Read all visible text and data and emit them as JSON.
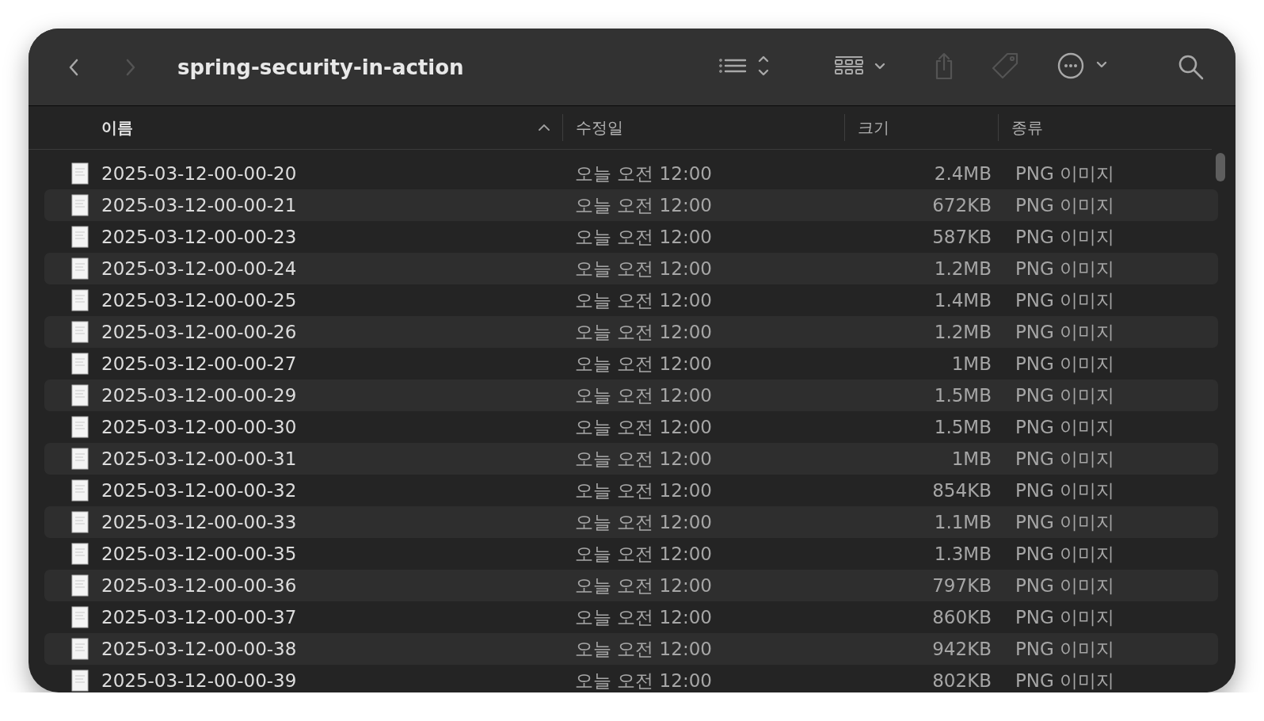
{
  "window": {
    "title": "spring-security-in-action"
  },
  "navigation": [
    {
      "kind": "back",
      "disabled": false
    },
    {
      "kind": "forward",
      "disabled": true
    }
  ],
  "toolbar": [
    {
      "kind": "list-view",
      "disabled": false
    },
    {
      "kind": "group",
      "disabled": false
    },
    {
      "kind": "share",
      "disabled": true
    },
    {
      "kind": "tag",
      "disabled": true
    },
    {
      "kind": "more",
      "disabled": false
    },
    {
      "kind": "search",
      "disabled": false
    }
  ],
  "columns": [
    {
      "label": "이름",
      "sorted": true
    },
    {
      "label": "수정일",
      "sorted": false
    },
    {
      "label": "크기",
      "sorted": false
    },
    {
      "label": "종류",
      "sorted": false
    }
  ],
  "rows": [
    {
      "name": "2025-03-12-00-00-20",
      "modified": "오늘 오전 12:00",
      "size": "2.4MB",
      "kind": "PNG 이미지"
    },
    {
      "name": "2025-03-12-00-00-21",
      "modified": "오늘 오전 12:00",
      "size": "672KB",
      "kind": "PNG 이미지"
    },
    {
      "name": "2025-03-12-00-00-23",
      "modified": "오늘 오전 12:00",
      "size": "587KB",
      "kind": "PNG 이미지"
    },
    {
      "name": "2025-03-12-00-00-24",
      "modified": "오늘 오전 12:00",
      "size": "1.2MB",
      "kind": "PNG 이미지"
    },
    {
      "name": "2025-03-12-00-00-25",
      "modified": "오늘 오전 12:00",
      "size": "1.4MB",
      "kind": "PNG 이미지"
    },
    {
      "name": "2025-03-12-00-00-26",
      "modified": "오늘 오전 12:00",
      "size": "1.2MB",
      "kind": "PNG 이미지"
    },
    {
      "name": "2025-03-12-00-00-27",
      "modified": "오늘 오전 12:00",
      "size": "1MB",
      "kind": "PNG 이미지"
    },
    {
      "name": "2025-03-12-00-00-29",
      "modified": "오늘 오전 12:00",
      "size": "1.5MB",
      "kind": "PNG 이미지"
    },
    {
      "name": "2025-03-12-00-00-30",
      "modified": "오늘 오전 12:00",
      "size": "1.5MB",
      "kind": "PNG 이미지"
    },
    {
      "name": "2025-03-12-00-00-31",
      "modified": "오늘 오전 12:00",
      "size": "1MB",
      "kind": "PNG 이미지"
    },
    {
      "name": "2025-03-12-00-00-32",
      "modified": "오늘 오전 12:00",
      "size": "854KB",
      "kind": "PNG 이미지"
    },
    {
      "name": "2025-03-12-00-00-33",
      "modified": "오늘 오전 12:00",
      "size": "1.1MB",
      "kind": "PNG 이미지"
    },
    {
      "name": "2025-03-12-00-00-35",
      "modified": "오늘 오전 12:00",
      "size": "1.3MB",
      "kind": "PNG 이미지"
    },
    {
      "name": "2025-03-12-00-00-36",
      "modified": "오늘 오전 12:00",
      "size": "797KB",
      "kind": "PNG 이미지"
    },
    {
      "name": "2025-03-12-00-00-37",
      "modified": "오늘 오전 12:00",
      "size": "860KB",
      "kind": "PNG 이미지"
    },
    {
      "name": "2025-03-12-00-00-38",
      "modified": "오늘 오전 12:00",
      "size": "942KB",
      "kind": "PNG 이미지"
    },
    {
      "name": "2025-03-12-00-00-39",
      "modified": "오늘 오전 12:00",
      "size": "802KB",
      "kind": "PNG 이미지"
    }
  ]
}
